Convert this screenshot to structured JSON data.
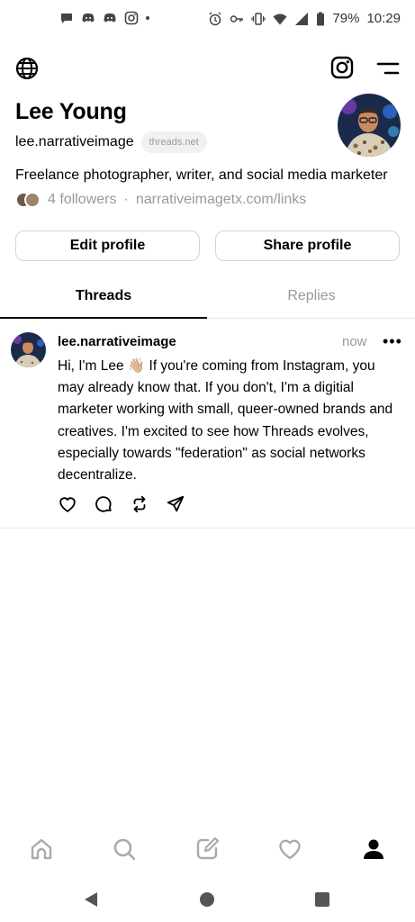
{
  "status_bar": {
    "battery": "79%",
    "time": "10:29",
    "left_icons": [
      "chat-bubble-icon",
      "discord-icon",
      "discord-icon",
      "instagram-icon",
      "dot-icon"
    ],
    "right_icons": [
      "alarm-icon",
      "key-icon",
      "vibrate-icon",
      "wifi-icon",
      "signal-icon",
      "battery-icon"
    ]
  },
  "top_bar": {
    "icons": [
      "globe-icon",
      "instagram-icon",
      "menu-icon"
    ]
  },
  "profile": {
    "name": "Lee Young",
    "handle": "lee.narrativeimage",
    "domain_badge": "threads.net",
    "bio": "Freelance photographer, writer, and social media marketer",
    "followers": "4 followers",
    "separator": "·",
    "link": "narrativeimagetx.com/links",
    "edit_button": "Edit profile",
    "share_button": "Share profile"
  },
  "tabs": [
    {
      "label": "Threads",
      "active": true
    },
    {
      "label": "Replies",
      "active": false
    }
  ],
  "post": {
    "username": "lee.narrativeimage",
    "time": "now",
    "more": "•••",
    "text": "Hi, I'm Lee 👋🏼 If you're coming from Instagram, you may already know that. If you don't, I'm a digitial marketer working with small, queer-owned brands and creatives. I'm excited to see how Threads evolves, especially towards \"federation\" as social networks decentralize.",
    "actions": [
      "heart-icon",
      "comment-icon",
      "repost-icon",
      "share-icon"
    ]
  },
  "bottom_nav": [
    "home-icon",
    "search-icon",
    "compose-icon",
    "activity-heart-icon",
    "profile-icon"
  ],
  "system_nav": [
    "back-icon",
    "home-circle-icon",
    "recents-icon"
  ],
  "colors": {
    "text": "#000000",
    "muted": "#999999",
    "border": "#d4d4d4",
    "pill_bg": "#f1f1f1"
  }
}
